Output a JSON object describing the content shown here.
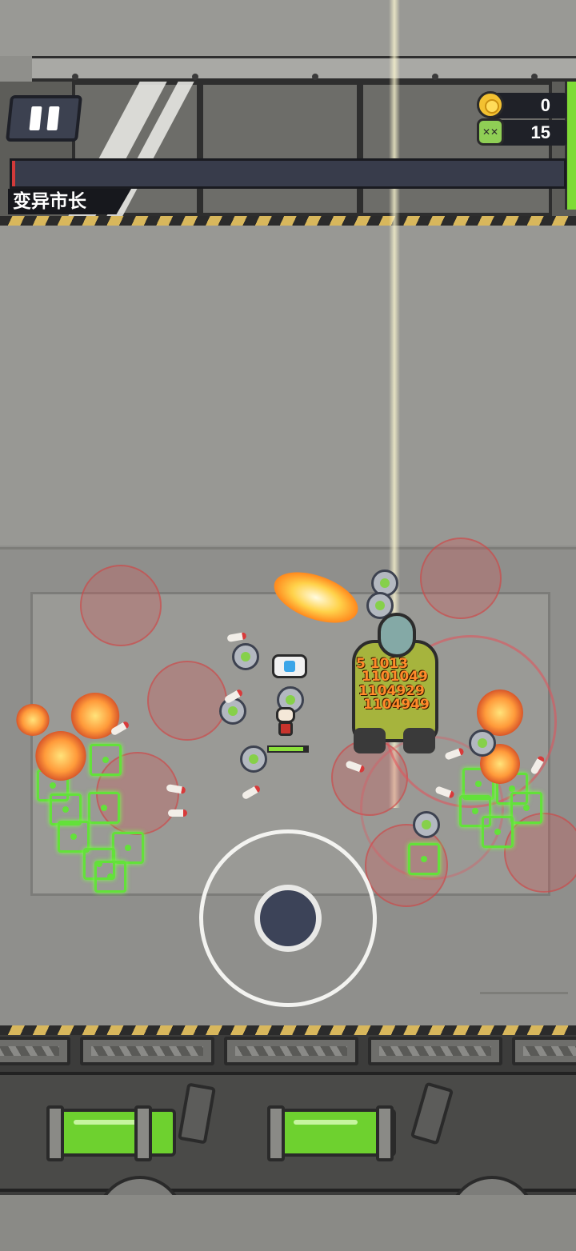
{
  "hud": {
    "coins": "0",
    "kills": "15",
    "boss_name": "变异市长",
    "boss_health_fraction": 0.006,
    "player_health_fraction": 0.9
  },
  "icons": {
    "pause": "pause-icon",
    "coin": "coin-icon",
    "kill": "skull-icon"
  },
  "damage_numbers": [
    "5 1013",
    "1101049",
    "1104929",
    "1104949"
  ],
  "colors": {
    "boss_bar_fill": "#d23a3a",
    "boss_bar_bg": "#383c4b",
    "player_hp": "#8adf3a",
    "reticle": "#63e13a",
    "joystick_knob": "#3c4358"
  }
}
